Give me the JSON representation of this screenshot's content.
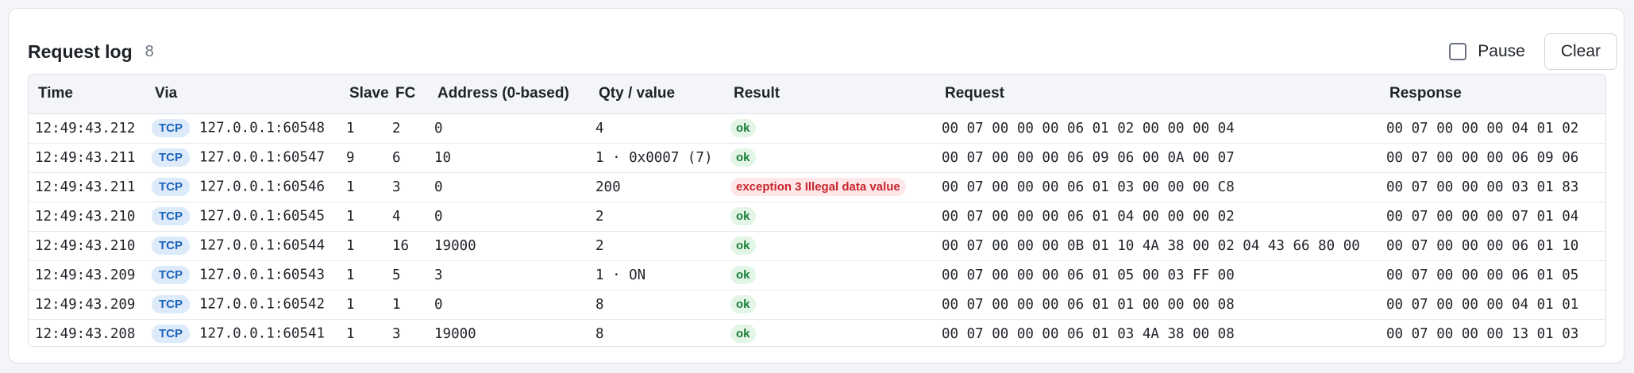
{
  "header": {
    "title": "Request log",
    "count": "8",
    "pause_label": "Pause",
    "clear_label": "Clear"
  },
  "colors": {
    "ok": "#1a7f37",
    "error": "#c9252d",
    "tag": "#1f63b8"
  },
  "columns": [
    "Time",
    "Via",
    "Slave",
    "FC",
    "Address (0-based)",
    "Qty / value",
    "Result",
    "Request",
    "Response"
  ],
  "rows": [
    {
      "time": "12:49:43.212",
      "via": "TCP",
      "addr": "127.0.0.1:60548",
      "slave": "1",
      "fc": "2",
      "address": "0",
      "qty": "4",
      "result": "ok",
      "status": "ok",
      "request": "00 07 00 00 00 06 01 02 00 00 00 04",
      "response": "00 07 00 00 00 04 01 02"
    },
    {
      "time": "12:49:43.211",
      "via": "TCP",
      "addr": "127.0.0.1:60547",
      "slave": "9",
      "fc": "6",
      "address": "10",
      "qty": "1 · 0x0007 (7)",
      "result": "ok",
      "status": "ok",
      "request": "00 07 00 00 00 06 09 06 00 0A 00 07",
      "response": "00 07 00 00 00 06 09 06"
    },
    {
      "time": "12:49:43.211",
      "via": "TCP",
      "addr": "127.0.0.1:60546",
      "slave": "1",
      "fc": "3",
      "address": "0",
      "qty": "200",
      "result": "exception 3 Illegal data value",
      "status": "err",
      "request": "00 07 00 00 00 06 01 03 00 00 00 C8",
      "response": "00 07 00 00 00 03 01 83"
    },
    {
      "time": "12:49:43.210",
      "via": "TCP",
      "addr": "127.0.0.1:60545",
      "slave": "1",
      "fc": "4",
      "address": "0",
      "qty": "2",
      "result": "ok",
      "status": "ok",
      "request": "00 07 00 00 00 06 01 04 00 00 00 02",
      "response": "00 07 00 00 00 07 01 04"
    },
    {
      "time": "12:49:43.210",
      "via": "TCP",
      "addr": "127.0.0.1:60544",
      "slave": "1",
      "fc": "16",
      "address": "19000",
      "qty": "2",
      "result": "ok",
      "status": "ok",
      "request": "00 07 00 00 00 0B 01 10 4A 38 00 02 04 43 66 80 00",
      "response": "00 07 00 00 00 06 01 10"
    },
    {
      "time": "12:49:43.209",
      "via": "TCP",
      "addr": "127.0.0.1:60543",
      "slave": "1",
      "fc": "5",
      "address": "3",
      "qty": "1 · ON",
      "result": "ok",
      "status": "ok",
      "request": "00 07 00 00 00 06 01 05 00 03 FF 00",
      "response": "00 07 00 00 00 06 01 05"
    },
    {
      "time": "12:49:43.209",
      "via": "TCP",
      "addr": "127.0.0.1:60542",
      "slave": "1",
      "fc": "1",
      "address": "0",
      "qty": "8",
      "result": "ok",
      "status": "ok",
      "request": "00 07 00 00 00 06 01 01 00 00 00 08",
      "response": "00 07 00 00 00 04 01 01"
    },
    {
      "time": "12:49:43.208",
      "via": "TCP",
      "addr": "127.0.0.1:60541",
      "slave": "1",
      "fc": "3",
      "address": "19000",
      "qty": "8",
      "result": "ok",
      "status": "ok",
      "request": "00 07 00 00 00 06 01 03 4A 38 00 08",
      "response": "00 07 00 00 00 13 01 03"
    }
  ]
}
